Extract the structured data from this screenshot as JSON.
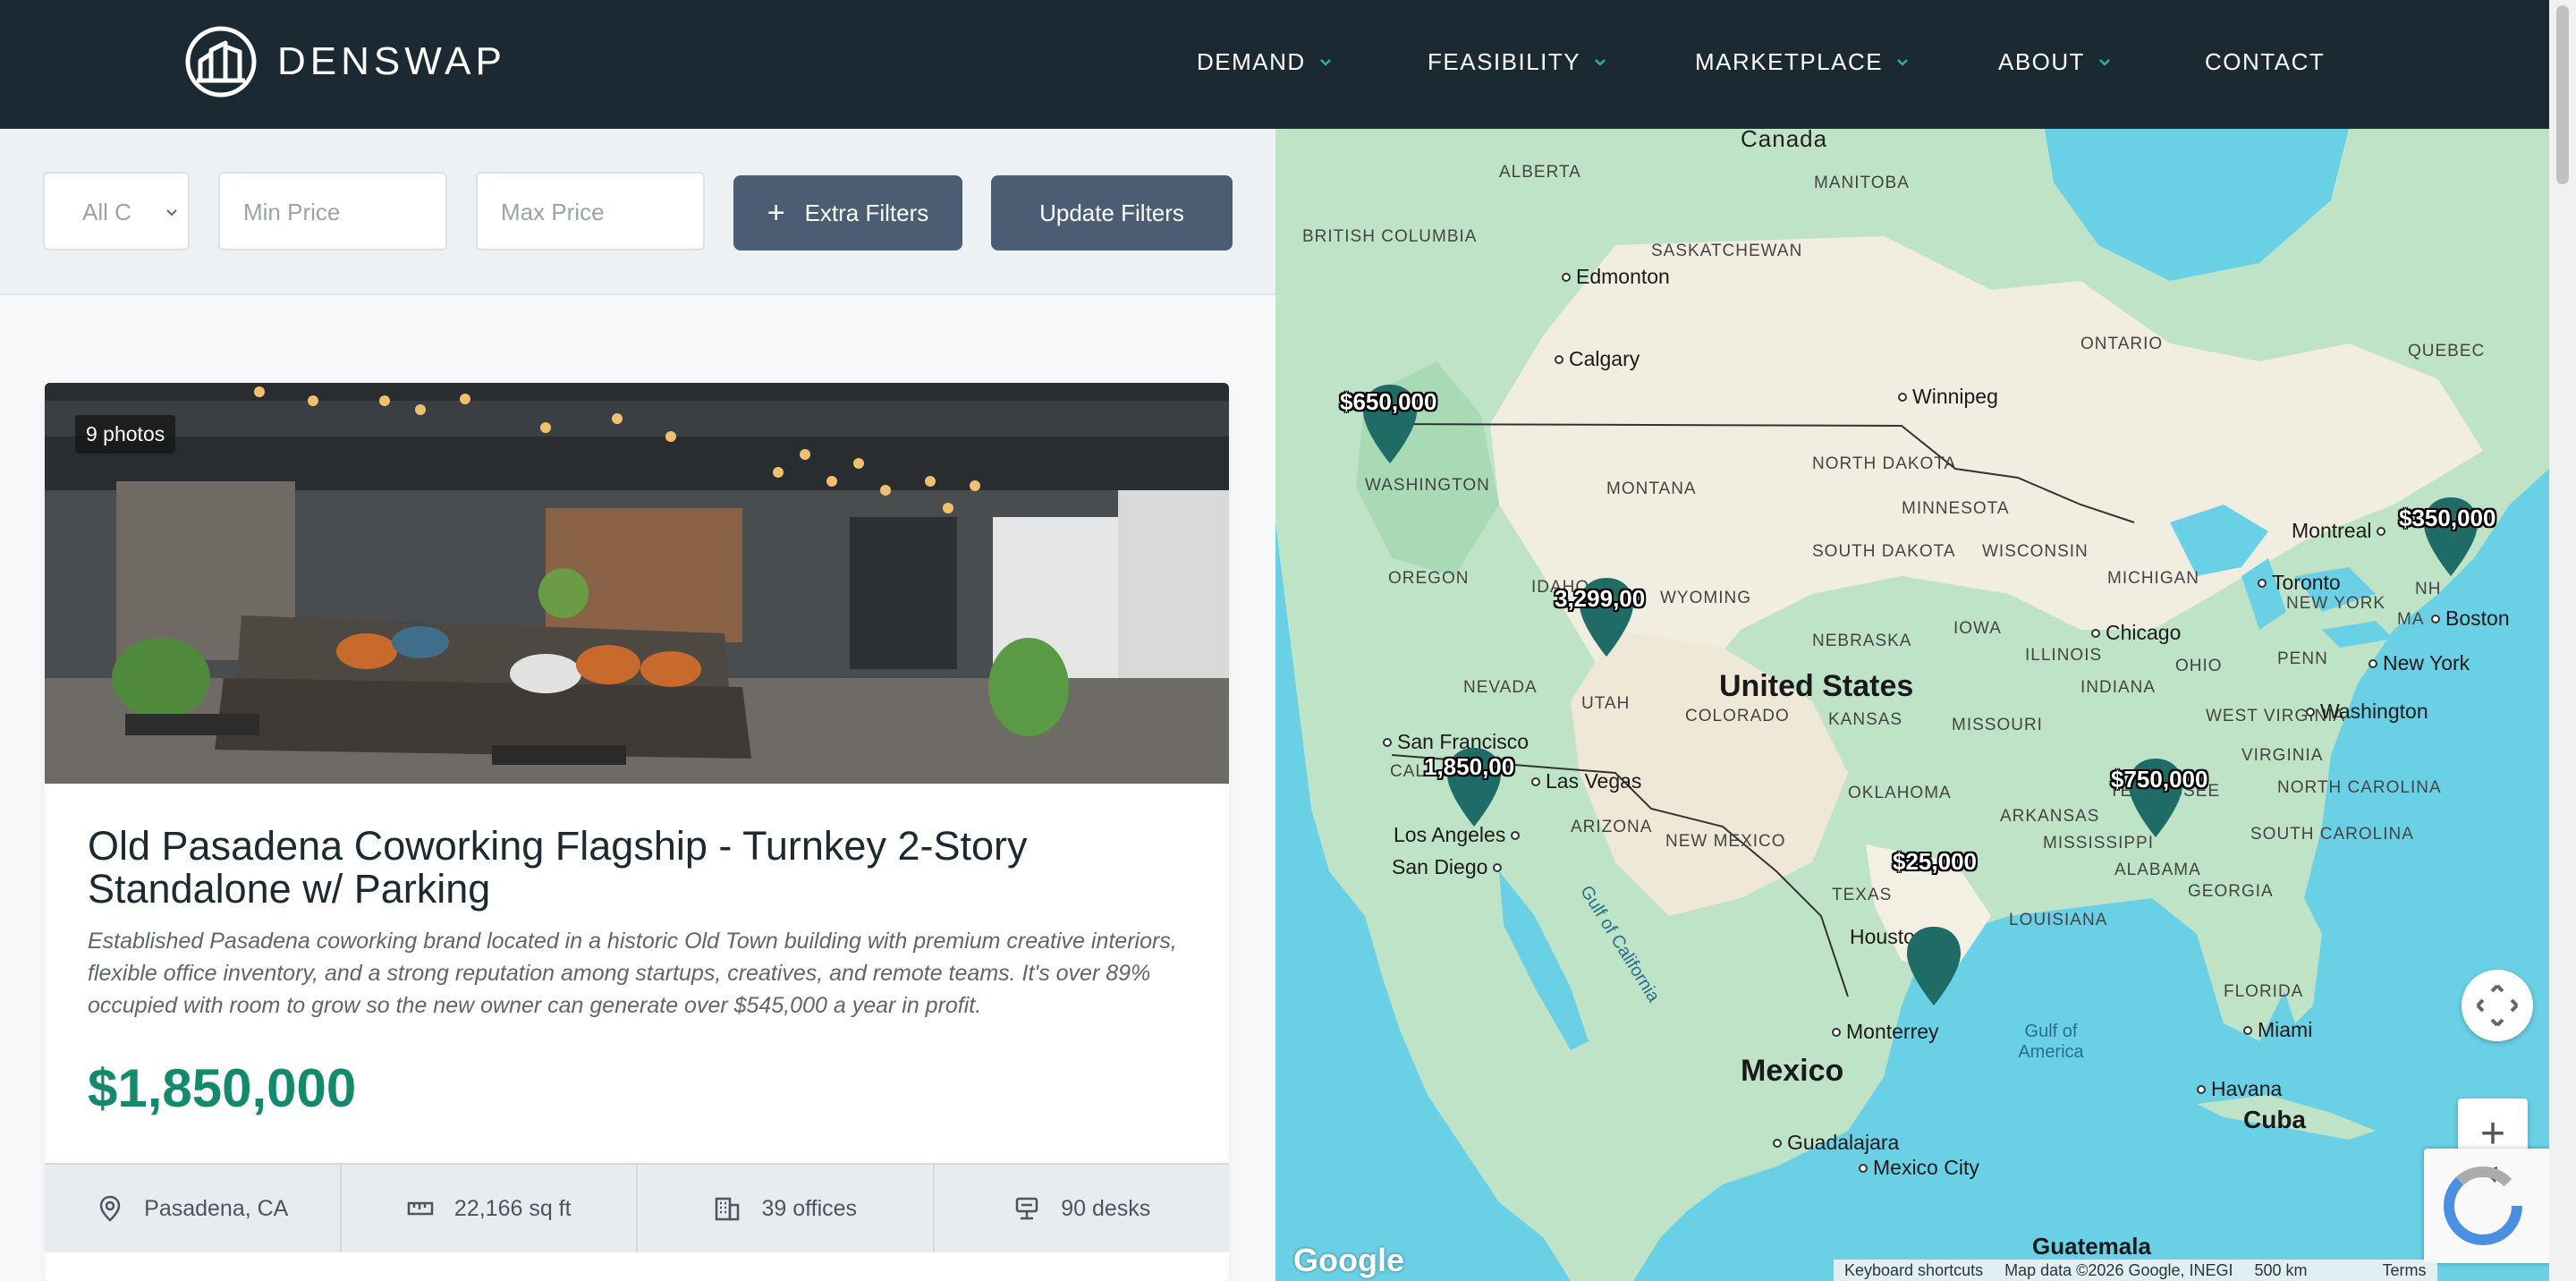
{
  "brand": {
    "name": "DENSWAP"
  },
  "nav": [
    {
      "label": "DEMAND",
      "has_dropdown": true
    },
    {
      "label": "FEASIBILITY",
      "has_dropdown": true
    },
    {
      "label": "MARKETPLACE",
      "has_dropdown": true
    },
    {
      "label": "ABOUT",
      "has_dropdown": true
    },
    {
      "label": "CONTACT",
      "has_dropdown": false
    }
  ],
  "filters": {
    "category_value": "All C",
    "min_price_placeholder": "Min Price",
    "max_price_placeholder": "Max Price",
    "extra_filters_label": "Extra Filters",
    "update_label": "Update Filters"
  },
  "listing": {
    "photos_badge": "9 photos",
    "title": "Old Pasadena Coworking Flagship - Turnkey 2-Story Standalone w/ Parking",
    "description": "Established Pasadena coworking brand located in a historic Old Town building with premium creative interiors, flexible office inventory, and a strong reputation among startups, creatives, and remote teams. It's over 89% occupied with room to grow so the new owner can generate over $545,000 a year in profit.",
    "price": "$1,850,000",
    "location": "Pasadena, CA",
    "size": "22,166 sq ft",
    "offices": "39 offices",
    "desks": "90 desks"
  },
  "map": {
    "country_labels": {
      "us": "United States",
      "mexico": "Mexico",
      "cuba": "Cuba",
      "guatemala": "Guatemala",
      "canada": "Canada"
    },
    "region_labels": [
      "ALBERTA",
      "MANITOBA",
      "BRITISH COLUMBIA",
      "SASKATCHEWAN",
      "ONTARIO",
      "QUEBEC",
      "WASHINGTON",
      "MONTANA",
      "NORTH DAKOTA",
      "MINNESOTA",
      "OREGON",
      "IDAHO",
      "WYOMING",
      "SOUTH DAKOTA",
      "WISCONSIN",
      "MICHIGAN",
      "NEW YORK",
      "NEBRASKA",
      "IOWA",
      "NEVADA",
      "UTAH",
      "COLORADO",
      "KANSAS",
      "ILLINOIS",
      "INDIANA",
      "OHIO",
      "PENN",
      "MISSOURI",
      "WEST VIRGINIA",
      "VIRGINIA",
      "ARIZONA",
      "NEW MEXICO",
      "OKLAHOMA",
      "ARKANSAS",
      "TENNESSEE",
      "NORTH CAROLINA",
      "SOUTH CAROLINA",
      "TEXAS",
      "MISSISSIPPI",
      "ALABAMA",
      "GEORGIA",
      "LOUISIANA",
      "FLORIDA",
      "NH",
      "MA",
      "CALI"
    ],
    "cities": [
      "Edmonton",
      "Calgary",
      "Winnipeg",
      "Montreal",
      "Toronto",
      "Boston",
      "New York",
      "Washington",
      "Chicago",
      "San Francisco",
      "Las Vegas",
      "Los Angeles",
      "San Diego",
      "Houston",
      "Monterrey",
      "Miami",
      "Havana",
      "Guadalajara",
      "Mexico City"
    ],
    "water_labels": [
      "Gulf of California",
      "Gulf of America"
    ],
    "pins": [
      {
        "label": "$650,000"
      },
      {
        "label": "3,299,00"
      },
      {
        "label": "1,850,00"
      },
      {
        "label": "$25,000"
      },
      {
        "label": "$750,000"
      },
      {
        "label": "$350,000"
      }
    ],
    "google_logo": "Google",
    "attribution": [
      "Keyboard shortcuts",
      "Map data ©2026 Google, INEGI",
      "500 km",
      "Terms"
    ]
  },
  "colors": {
    "header_bg": "#1b2a32",
    "accent_green": "#138a6e",
    "pin": "#1f6b66",
    "button": "#4a5d72"
  }
}
